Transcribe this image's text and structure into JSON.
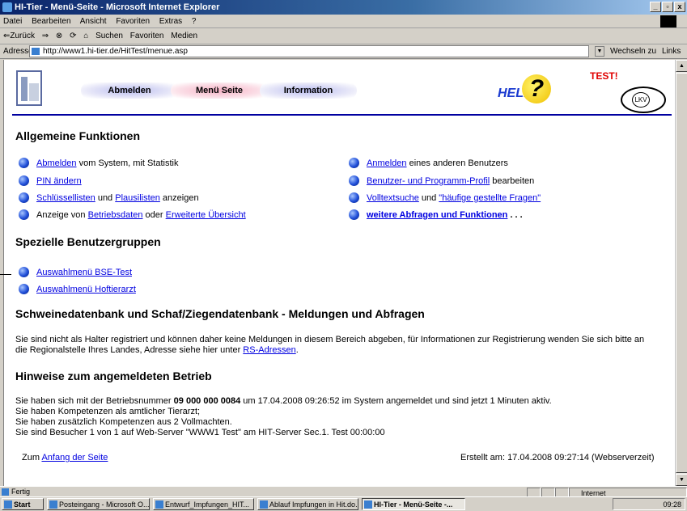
{
  "window": {
    "title": "HI-Tier - Menü-Seite - Microsoft Internet Explorer",
    "controls": [
      "_",
      "▫",
      "x"
    ]
  },
  "menubar": [
    "Datei",
    "Bearbeiten",
    "Ansicht",
    "Favoriten",
    "Extras",
    "?"
  ],
  "toolbar": {
    "back": "⇐Zurück",
    "forward": "⇒",
    "search": "Suchen",
    "favorites": "Favoriten",
    "media": "Medien"
  },
  "address": {
    "label": "Adresse",
    "url": "http://www1.hi-tier.de/HitTest/menue.asp",
    "go": "Wechseln zu",
    "links": "Links"
  },
  "header": {
    "nav": [
      "Abmelden",
      "Menü Seite",
      "Information"
    ],
    "help_text": "HELP",
    "help_mark": "?",
    "test_label": "TEST!",
    "lkv_label": "LKV"
  },
  "sections": {
    "general": {
      "title": "Allgemeine Funktionen",
      "left": [
        {
          "link": "Abmelden",
          "text": " vom System, mit Statistik"
        },
        {
          "link": "PIN ändern",
          "text": ""
        },
        {
          "link": "Schlüssellisten",
          "mid": " und ",
          "link2": "Plausilisten",
          "text": " anzeigen"
        },
        {
          "pre": "Anzeige von ",
          "link": "Betriebsdaten",
          "mid": " oder ",
          "link2": "Erweiterte Übersicht"
        }
      ],
      "right": [
        {
          "link": "Anmelden",
          "text": " eines anderen Benutzers"
        },
        {
          "link": "Benutzer- und Programm-Profil",
          "text": " bearbeiten"
        },
        {
          "link": "Volltextsuche",
          "mid": " und ",
          "link2": "\"häufige gestellte Fragen\""
        },
        {
          "link": "weitere Abfragen und Funktionen",
          "text": " . . ."
        }
      ]
    },
    "special": {
      "title": "Spezielle Benutzergruppen",
      "items": [
        "Auswahlmenü BSE-Test",
        "Auswahlmenü Hoftierarzt"
      ]
    },
    "pig": {
      "title": "Schweinedatenbank und Schaf/Ziegendatenbank - Meldungen und Abfragen",
      "line1": "Sie sind nicht als Halter registriert und können daher keine Meldungen in diesem Bereich abgeben, für Informationen zur Registrierung wenden Sie sich bitte an",
      "line2": "die Regionalstelle Ihres Landes, Adresse siehe hier unter ",
      "link": "RS-Adressen",
      "end": "."
    },
    "notes": {
      "title": "Hinweise zum angemeldeten Betrieb",
      "l1a": "Sie haben sich mit der Betriebsnummer ",
      "l1b": "09 000 000 0084",
      "l1c": " um 17.04.2008 09:26:52 im System angemeldet und sind jetzt 1 Minuten aktiv.",
      "l2": "Sie haben Kompetenzen als amtlicher Tierarzt;",
      "l3": "Sie haben zusätzlich Kompetenzen aus 2 Vollmachten.",
      "l4": "Sie sind Besucher 1 von 1 auf Web-Server \"WWW1 Test\" am HIT-Server Sec.1. Test 00:00:00"
    },
    "footer": {
      "pre": "Zum ",
      "link": "Anfang der Seite",
      "created": "Erstellt am: 17.04.2008 09:27:14 (Webserverzeit)"
    }
  },
  "status": {
    "text": "Fertig",
    "zone": "Internet"
  },
  "taskbar": {
    "start": "Start",
    "buttons": [
      "Posteingang - Microsoft O...",
      "Entwurf_Impfungen_HIT...",
      "Ablauf Impfungen in Hit.do...",
      "HI-Tier - Menü-Seite -..."
    ],
    "clock": "09:28"
  },
  "colors": {
    "nav_blue": "#b9bcef",
    "nav_pink": "#f5b1c4",
    "bullet": "#1f4ed8",
    "rule": "#0000a0",
    "test": "#e00000"
  }
}
